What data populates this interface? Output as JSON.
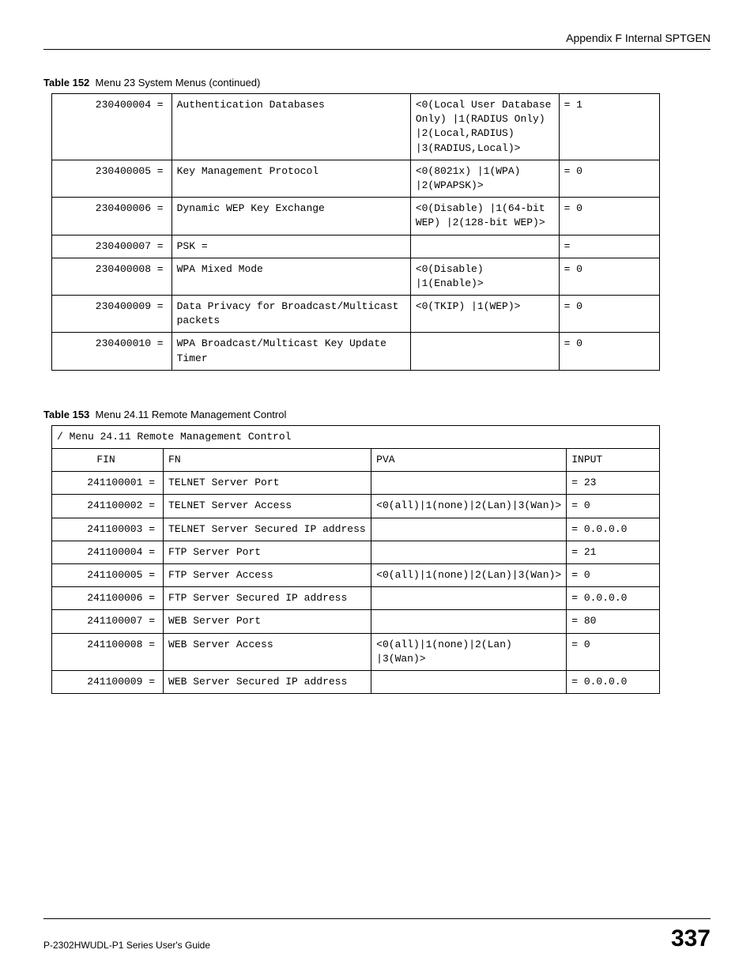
{
  "header": {
    "appendix": "Appendix F Internal SPTGEN"
  },
  "table152": {
    "caption_prefix": "Table 152",
    "caption_text": "Menu 23 System Menus  (continued)",
    "rows": [
      {
        "fin": "230400004 =",
        "fn": "Authentication Databases",
        "pva": "<0(Local User Database Only) |1(RADIUS Only) |2(Local,RADIUS) |3(RADIUS,Local)>",
        "input": "= 1"
      },
      {
        "fin": "230400005 =",
        "fn": "Key Management Protocol",
        "pva": "<0(8021x) |1(WPA) |2(WPAPSK)>",
        "input": "= 0"
      },
      {
        "fin": "230400006 =",
        "fn": "Dynamic WEP Key Exchange",
        "pva": "<0(Disable) |1(64-bit WEP) |2(128-bit WEP)>",
        "input": "= 0"
      },
      {
        "fin": "230400007 =",
        "fn": "PSK  =",
        "pva": "",
        "input": "="
      },
      {
        "fin": "230400008 =",
        "fn": "WPA Mixed Mode",
        "pva": "<0(Disable) |1(Enable)>",
        "input": "= 0"
      },
      {
        "fin": "230400009 =",
        "fn": "Data Privacy for Broadcast/Multicast packets",
        "pva": " <0(TKIP) |1(WEP)>",
        "input": "= 0"
      },
      {
        "fin": "230400010 =",
        "fn": "WPA Broadcast/Multicast Key Update Timer",
        "pva": "",
        "input": "= 0"
      }
    ]
  },
  "table153": {
    "caption_prefix": "Table 153",
    "caption_text": "Menu 24.11 Remote Management Control",
    "title_row": "/ Menu 24.11 Remote Management Control",
    "headers": {
      "fin": "FIN",
      "fn": "FN",
      "pva": "PVA",
      "input": "INPUT"
    },
    "rows": [
      {
        "fin": "241100001 =",
        "fn": "TELNET Server Port",
        "pva": "",
        "input": "= 23"
      },
      {
        "fin": "241100002 =",
        "fn": "TELNET Server Access",
        "pva": "<0(all)|1(none)|2(Lan)|3(Wan)>",
        "input": "= 0"
      },
      {
        "fin": "241100003 =",
        "fn": "TELNET Server Secured IP address",
        "pva": "",
        "input": "= 0.0.0.0"
      },
      {
        "fin": "241100004 =",
        "fn": "FTP Server Port",
        "pva": "",
        "input": "= 21"
      },
      {
        "fin": "241100005 =",
        "fn": "FTP Server Access",
        "pva": "<0(all)|1(none)|2(Lan)|3(Wan)>",
        "input": "= 0"
      },
      {
        "fin": "241100006 =",
        "fn": "FTP Server Secured IP address",
        "pva": "",
        "input": "= 0.0.0.0"
      },
      {
        "fin": "241100007 =",
        "fn": "WEB Server Port",
        "pva": "",
        "input": "= 80"
      },
      {
        "fin": "241100008 =",
        "fn": "WEB Server Access",
        "pva": "<0(all)|1(none)|2(Lan) |3(Wan)>",
        "input": "= 0"
      },
      {
        "fin": "241100009 =",
        "fn": "WEB Server Secured IP address",
        "pva": "",
        "input": "= 0.0.0.0"
      }
    ]
  },
  "footer": {
    "guide": "P-2302HWUDL-P1 Series User's Guide",
    "page": "337"
  }
}
